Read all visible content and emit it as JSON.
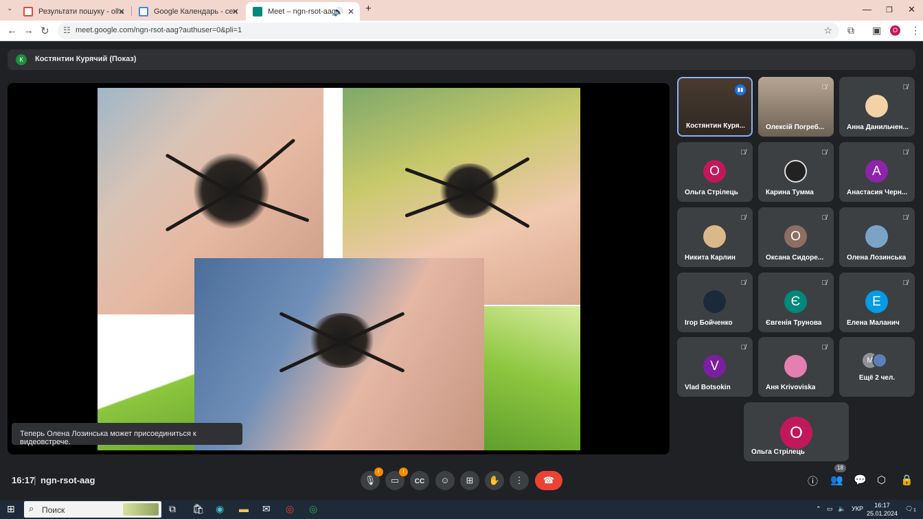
{
  "browser": {
    "tabs": [
      {
        "title": "Результати пошуку - olhastrile",
        "icon": "gmail-icon",
        "color": "#ea4335"
      },
      {
        "title": "Google Календарь - сентябрь",
        "icon": "calendar-icon",
        "color": "#4285f4"
      },
      {
        "title": "Meet – ngn-rsot-aag",
        "icon": "meet-icon",
        "color": "#00897b",
        "active": true
      }
    ],
    "url": "meet.google.com/ngn-rsot-aag?authuser=0&pli=1",
    "profile_initial": "О",
    "new_tab": "+"
  },
  "meet": {
    "presenter": {
      "initial": "К",
      "label": "Костянтин Курячий (Показ)"
    },
    "toast": "Теперь Олена Лозинська может присоединиться к видеовстрече.",
    "participants": [
      {
        "name": "Костянтин Куря...",
        "type": "video",
        "speaking": true
      },
      {
        "name": "Олексій Погреб...",
        "type": "video"
      },
      {
        "name": "Анна Данильчен...",
        "type": "photo",
        "color": "#f3d2a6"
      },
      {
        "name": "Ольга Стрілець",
        "initial": "О",
        "color": "#c2185b"
      },
      {
        "name": "Карина Тумма",
        "type": "photo",
        "color": "#222222"
      },
      {
        "name": "Анастасия Черн...",
        "initial": "А",
        "color": "#8e24aa"
      },
      {
        "name": "Никита Карлин",
        "type": "photo",
        "color": "#d9b98a"
      },
      {
        "name": "Оксана Сидоре...",
        "initial": "О",
        "color": "#8d6e63"
      },
      {
        "name": "Олена Лозинська",
        "type": "photo",
        "color": "#7aa3c7"
      },
      {
        "name": "Ігор Бойченко",
        "type": "photo",
        "color": "#1b2a3a"
      },
      {
        "name": "Євгенія Трунова",
        "initial": "Є",
        "color": "#00897b"
      },
      {
        "name": "Елена Маланич",
        "initial": "Е",
        "color": "#039be5"
      },
      {
        "name": "Vlad Botsokin",
        "initial": "V",
        "color": "#7b1fa2"
      },
      {
        "name": "Аня Krivoviska",
        "type": "photo",
        "color": "#e57fb0"
      }
    ],
    "more": {
      "initial": "М",
      "label": "Ещё 2 чел."
    },
    "self_tile": {
      "initial": "О",
      "name": "Ольга Стрілець",
      "color": "#c2185b"
    },
    "footer": {
      "time": "16:17",
      "separator": "|",
      "code": "ngn-rsot-aag",
      "mic_badge": "!",
      "cam_badge": "!",
      "people_count": "18"
    }
  },
  "taskbar": {
    "search_label": "Поиск",
    "lang": "УКР",
    "time": "16:17",
    "date": "25.01.2024",
    "notif_count": "1"
  }
}
